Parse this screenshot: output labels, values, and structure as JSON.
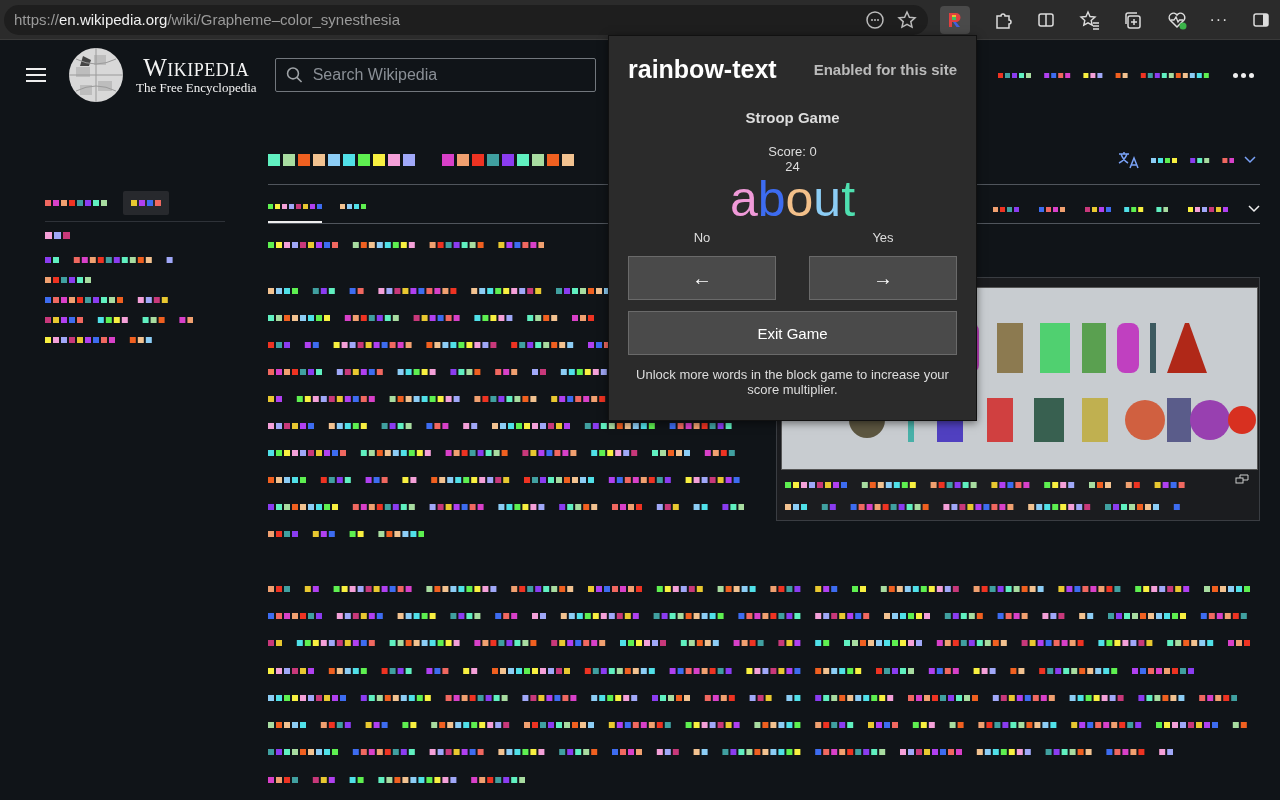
{
  "browser": {
    "address": {
      "scheme": "https://",
      "host": "en.wikipedia.org",
      "path": "/wiki/Grapheme–color_synesthesia"
    },
    "more_label": "···"
  },
  "wiki": {
    "wordmark": "Wikipedia",
    "tagline": "The Free Encyclopedia",
    "search": {
      "placeholder": "Search Wikipedia"
    },
    "article_tabs": [
      {
        "selected": true
      },
      {
        "selected": false
      }
    ]
  },
  "popup": {
    "title": "rainbow-text",
    "status": "Enabled for this site",
    "game_title": "Stroop Game",
    "score": "Score: 0",
    "timer": "24",
    "word": [
      {
        "text": "a",
        "color": "#f09ad8"
      },
      {
        "text": "b",
        "color": "#3d6cf0"
      },
      {
        "text": "o",
        "color": "#f3c08a"
      },
      {
        "text": "u",
        "color": "#8ccdf5"
      },
      {
        "text": "t",
        "color": "#4fe0b0"
      }
    ],
    "choices": [
      {
        "label": "No",
        "key": "←"
      },
      {
        "label": "Yes",
        "key": "→"
      }
    ],
    "exit_button": "Exit Game",
    "note": "Unlock more words in the block game to increase your score multiplier."
  }
}
